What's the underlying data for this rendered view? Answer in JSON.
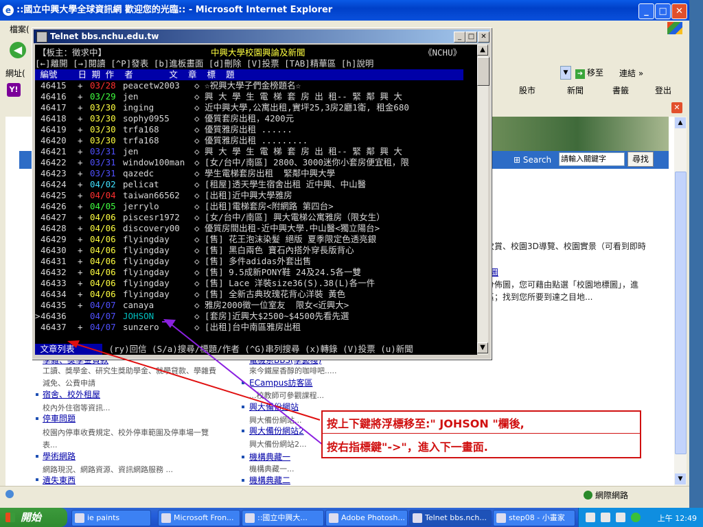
{
  "ie": {
    "title": "::國立中興大學全球資訊網 歡迎您的光臨:: - Microsoft Internet Explorer",
    "menu_label": "檔案(",
    "address_label": "網址(",
    "go_label": "移至",
    "links_label": "連結",
    "yahoo_tools": [
      "股市",
      "新聞",
      "書籤",
      "登出"
    ],
    "status_zone": "網際網路"
  },
  "webpage": {
    "search_label": "Search",
    "search_placeholder": "請輸入關鍵字",
    "search_button": "尋找",
    "right_text_1": "次賞、校園3D導覽、校園實景（可看到即時",
    "right_text_2": "圖",
    "right_text_3": "分佈圖，您可藉由點選「校園地標圖」，進",
    "right_text_4": "區；找到您所要到達之目地...",
    "left_col": [
      {
        "link": "學雜、獎學金貸款",
        "desc": "工讀、獎學金、研究生獎助學金、就學貸款、學雜費"
      },
      {
        "link": "",
        "desc": "減免、公費申請"
      },
      {
        "link": "宿舍、校外租屋",
        "desc": "校內外住宿等資訊..."
      },
      {
        "link": "停車問題",
        "desc": "校園內停車收費規定、校外停車範圍及停車場一覽"
      },
      {
        "link": "",
        "desc": "表..."
      },
      {
        "link": "學術網路",
        "desc": "網路現況、網路資源、資訊網路服務 ..."
      },
      {
        "link": "遺失東西",
        "desc": ""
      }
    ],
    "right_col": [
      {
        "link": "電機系BBS(學藝棧)",
        "desc": "來今鐵屋香醇的咖啡吧....."
      },
      {
        "link": "ECampus訪客區",
        "desc": "...校教師可參觀課程..."
      },
      {
        "link": "興大備份網站",
        "desc": "興大備份網站..."
      },
      {
        "link": "興大備份網站2",
        "desc": "興大備份網站2..."
      },
      {
        "link": "機構典藏一",
        "desc": "機構典藏一..."
      },
      {
        "link": "機構典藏二",
        "desc": ""
      }
    ]
  },
  "telnet": {
    "title": "Telnet bbs.nchu.edu.tw",
    "board_owner": "【板主：徵求中】",
    "board_name": "中興大學校園興論及新聞",
    "board_tag": "《NCHU》",
    "help_line": "[←]離開 [→]閱讀 [^P]發表 [b]進板畫面 [d]刪除 [V]投票 [TAB]精華區 [h]說明",
    "header": " 編號    日 期 作  者       文  章  標  題",
    "footer_label": " 文章列表 ",
    "footer_help": " (ry)回信 (S/a)搜尋/標題/作者 (^G)串列搜尋 (x)轉錄 (V)投票 (u)新聞",
    "posts": [
      {
        "num": "46415",
        "mark": "+",
        "date": "03/28",
        "date_color": "red",
        "author": "peacetw2003",
        "title": "◇ ☆祝興大學子們金榜題名☆"
      },
      {
        "num": "46416",
        "mark": "+",
        "date": "03/29",
        "date_color": "green",
        "author": "jen",
        "title": "◇ 興 大 學 生 電 梯 套 房 出 租-- 緊 鄰 興 大"
      },
      {
        "num": "46417",
        "mark": "+",
        "date": "03/30",
        "date_color": "yellow",
        "author": "inging",
        "title": "◇ 近中興大學,公寓出租,實坪25,3房2廳1衛, 租金680"
      },
      {
        "num": "46418",
        "mark": "+",
        "date": "03/30",
        "date_color": "yellow",
        "author": "sophy0955",
        "title": "◇ 優質套房出租，4200元"
      },
      {
        "num": "46419",
        "mark": "+",
        "date": "03/30",
        "date_color": "yellow",
        "author": "trfa168",
        "title": "◇ 優質雅房出租 ......"
      },
      {
        "num": "46420",
        "mark": "+",
        "date": "03/30",
        "date_color": "yellow",
        "author": "trfa168",
        "title": "◇ 優質雅房出租 ........."
      },
      {
        "num": "46421",
        "mark": "+",
        "date": "03/31",
        "date_color": "blue",
        "author": "jen",
        "title": "◇ 興 大 學 生 電 梯 套 房 出 租-- 緊 鄰 興 大"
      },
      {
        "num": "46422",
        "mark": "+",
        "date": "03/31",
        "date_color": "blue",
        "author": "window100man",
        "title": "◇ [女/台中/南區] 2800、3000迷你小套房便宜租，限"
      },
      {
        "num": "46423",
        "mark": "+",
        "date": "03/31",
        "date_color": "blue",
        "author": "qazedc",
        "title": "◇ 學生電梯套房出租  緊鄰中興大學"
      },
      {
        "num": "46424",
        "mark": "+",
        "date": "04/02",
        "date_color": "cyan",
        "author": "pelicat",
        "title": "◇ [租屋]透天學生宿舍出租 近中興、中山醫"
      },
      {
        "num": "46425",
        "mark": "+",
        "date": "04/04",
        "date_color": "red",
        "author": "taiwan66562",
        "title": "◇ [出租]近中興大學雅房"
      },
      {
        "num": "46426",
        "mark": "+",
        "date": "04/05",
        "date_color": "green",
        "author": "jerrylo",
        "title": "◇ [出租]電梯套房<附網路 第四台>"
      },
      {
        "num": "46427",
        "mark": "+",
        "date": "04/06",
        "date_color": "yellow",
        "author": "piscesr1972",
        "title": "◇ [女/台中/南區] 興大電梯公寓雅房（限女生）"
      },
      {
        "num": "46428",
        "mark": "+",
        "date": "04/06",
        "date_color": "yellow",
        "author": "discovery00",
        "title": "◇ 優質房間出租-近中興大學.中山醫<獨立陽台>"
      },
      {
        "num": "46429",
        "mark": "+",
        "date": "04/06",
        "date_color": "yellow",
        "author": "flyingday",
        "title": "◇ [售] 花王泡沫染髮 絕版 夏季限定色透亮銀"
      },
      {
        "num": "46430",
        "mark": "+",
        "date": "04/06",
        "date_color": "yellow",
        "author": "flyingday",
        "title": "◇ [售] 黑白兩色 寶石內搭外穿長版背心"
      },
      {
        "num": "46431",
        "mark": "+",
        "date": "04/06",
        "date_color": "yellow",
        "author": "flyingday",
        "title": "◇ [售] 多件adidas外套出售"
      },
      {
        "num": "46432",
        "mark": "+",
        "date": "04/06",
        "date_color": "yellow",
        "author": "flyingday",
        "title": "◇ [售] 9.5成新PONY鞋 24及24.5各一雙"
      },
      {
        "num": "46433",
        "mark": "+",
        "date": "04/06",
        "date_color": "yellow",
        "author": "flyingday",
        "title": "◇ [售] Lace 洋裝size36(S).38(L)各一件"
      },
      {
        "num": "46434",
        "mark": "+",
        "date": "04/06",
        "date_color": "yellow",
        "author": "flyingday",
        "title": "◇ [售] 全新古典玫瑰花背心洋裝 黃色"
      },
      {
        "num": "46435",
        "mark": "+",
        "date": "04/07",
        "date_color": "blue",
        "author": "canaya",
        "title": "◇ 雅房2000徵一位室友  限女<近興大>"
      },
      {
        "num": "46436",
        "mark": " ",
        "date": "04/07",
        "date_color": "blue",
        "author": "JOHSON",
        "title": "◇ [套房]近興大$2500~$4500先看先選",
        "selected": true
      },
      {
        "num": "46437",
        "mark": "+",
        "date": "04/07",
        "date_color": "blue",
        "author": "sunzero",
        "title": "◇ [出租]台中南區雅房出租"
      }
    ]
  },
  "callout": {
    "line1": "按上下鍵將浮標移至:\" JOHSON \"欄後,",
    "line2": "按右指標鍵\"->\"，進入下一畫面."
  },
  "taskbar": {
    "start": "開始",
    "tasks": [
      "ie paints",
      "Microsoft Fron...",
      "::國立中興大...",
      "Adobe Photosh...",
      "Telnet bbs.nch...",
      "step08 - 小畫家"
    ],
    "clock": "上午 12:49"
  }
}
